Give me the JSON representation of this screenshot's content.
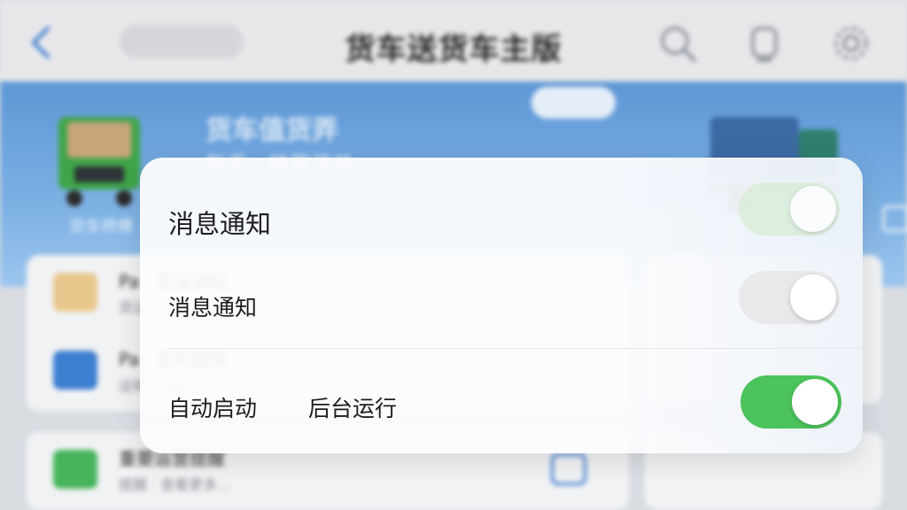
{
  "app": {
    "title": "货车送货车主版"
  },
  "banner": {
    "title": "货车值货弄",
    "subtitle": "新手 · 推荐货单",
    "truck_label": "货车师傅"
  },
  "background_rows": [
    {
      "title": "Pa · 货运通知",
      "subtitle": "货运 · 消息"
    },
    {
      "title": "Pa · 货车服务",
      "subtitle": "运输 · 货单"
    },
    {
      "title": "重要运营提醒",
      "subtitle": "提醒 · 查看更多..."
    }
  ],
  "dialog": {
    "title": "消息通知",
    "rows": [
      {
        "label": "消息通知",
        "toggle_state": "off"
      },
      {
        "label": "自动启动",
        "label2": "后台运行",
        "toggle_state": "on"
      }
    ]
  },
  "colors": {
    "toggle_on": "#4cc35c",
    "banner": "#6aa2dc",
    "dialog_bg": "#fcfcfd"
  },
  "icons": [
    "back-arrow-icon",
    "search-icon",
    "bell-icon",
    "gear-icon",
    "truck-icon"
  ]
}
